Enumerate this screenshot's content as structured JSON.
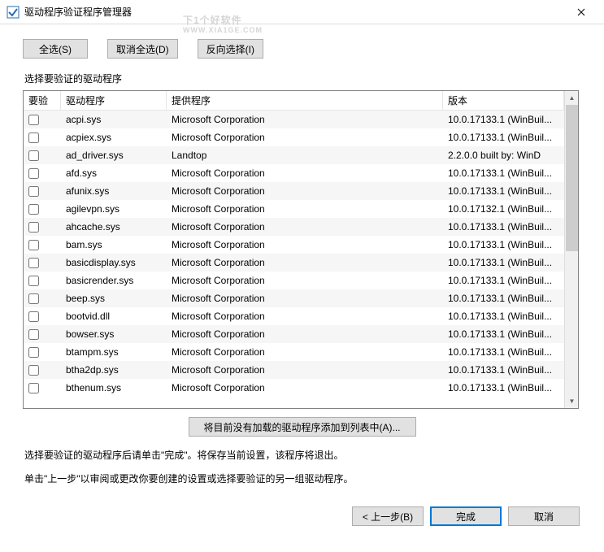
{
  "titlebar": {
    "title": "驱动程序验证程序管理器"
  },
  "watermark": {
    "line1": "下1个好软件",
    "line2": "WWW.XIA1GE.COM"
  },
  "buttons": {
    "select_all": "全选(S)",
    "deselect_all": "取消全选(D)",
    "invert": "反向选择(I)",
    "add_unloaded": "将目前没有加载的驱动程序添加到列表中(A)...",
    "back": "< 上一步(B)",
    "finish": "完成",
    "cancel": "取消"
  },
  "groupbox": {
    "label": "选择要验证的驱动程序"
  },
  "columns": {
    "check": "要验",
    "driver": "驱动程序",
    "provider": "提供程序",
    "version": "版本"
  },
  "rows": [
    {
      "driver": "acpi.sys",
      "provider": "Microsoft Corporation",
      "version": "10.0.17133.1 (WinBuil..."
    },
    {
      "driver": "acpiex.sys",
      "provider": "Microsoft Corporation",
      "version": "10.0.17133.1 (WinBuil..."
    },
    {
      "driver": "ad_driver.sys",
      "provider": "Landtop",
      "version": "2.2.0.0 built by: WinD"
    },
    {
      "driver": "afd.sys",
      "provider": "Microsoft Corporation",
      "version": "10.0.17133.1 (WinBuil..."
    },
    {
      "driver": "afunix.sys",
      "provider": "Microsoft Corporation",
      "version": "10.0.17133.1 (WinBuil..."
    },
    {
      "driver": "agilevpn.sys",
      "provider": "Microsoft Corporation",
      "version": "10.0.17132.1 (WinBuil..."
    },
    {
      "driver": "ahcache.sys",
      "provider": "Microsoft Corporation",
      "version": "10.0.17133.1 (WinBuil..."
    },
    {
      "driver": "bam.sys",
      "provider": "Microsoft Corporation",
      "version": "10.0.17133.1 (WinBuil..."
    },
    {
      "driver": "basicdisplay.sys",
      "provider": "Microsoft Corporation",
      "version": "10.0.17133.1 (WinBuil..."
    },
    {
      "driver": "basicrender.sys",
      "provider": "Microsoft Corporation",
      "version": "10.0.17133.1 (WinBuil..."
    },
    {
      "driver": "beep.sys",
      "provider": "Microsoft Corporation",
      "version": "10.0.17133.1 (WinBuil..."
    },
    {
      "driver": "bootvid.dll",
      "provider": "Microsoft Corporation",
      "version": "10.0.17133.1 (WinBuil..."
    },
    {
      "driver": "bowser.sys",
      "provider": "Microsoft Corporation",
      "version": "10.0.17133.1 (WinBuil..."
    },
    {
      "driver": "btampm.sys",
      "provider": "Microsoft Corporation",
      "version": "10.0.17133.1 (WinBuil..."
    },
    {
      "driver": "btha2dp.sys",
      "provider": "Microsoft Corporation",
      "version": "10.0.17133.1 (WinBuil..."
    },
    {
      "driver": "bthenum.sys",
      "provider": "Microsoft Corporation",
      "version": "10.0.17133.1 (WinBuil..."
    }
  ],
  "info": {
    "line1": "选择要验证的驱动程序后请单击\"完成\"。将保存当前设置，该程序将退出。",
    "line2": "单击\"上一步\"以审阅或更改你要创建的设置或选择要验证的另一组驱动程序。"
  }
}
